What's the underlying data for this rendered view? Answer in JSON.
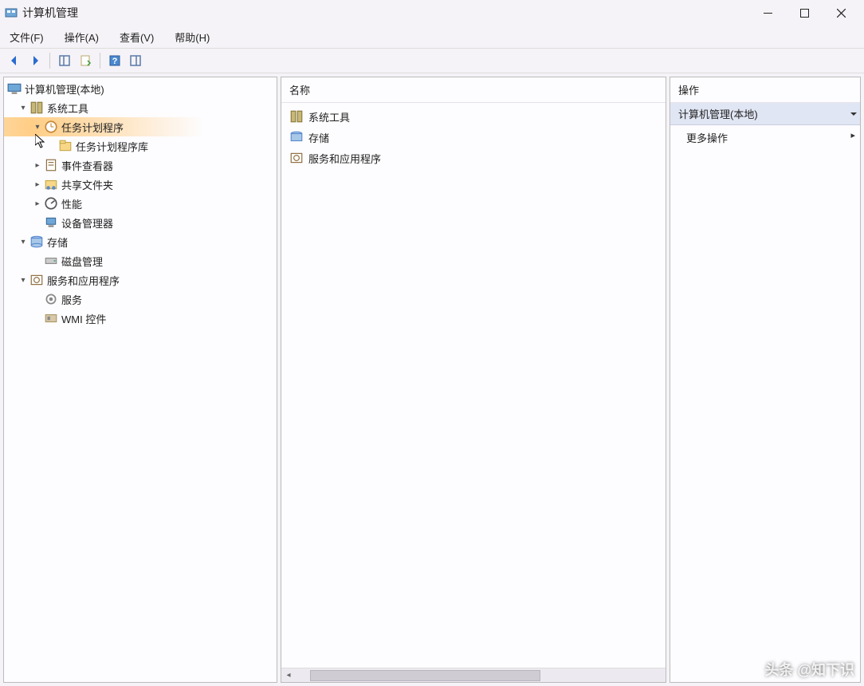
{
  "window": {
    "title": "计算机管理"
  },
  "menubar": {
    "file": "文件(F)",
    "action": "操作(A)",
    "view": "查看(V)",
    "help": "帮助(H)"
  },
  "tree": {
    "root": "计算机管理(本地)",
    "system_tools": "系统工具",
    "task_scheduler": "任务计划程序",
    "task_scheduler_library": "任务计划程序库",
    "event_viewer": "事件查看器",
    "shared_folders": "共享文件夹",
    "performance": "性能",
    "device_manager": "设备管理器",
    "storage": "存储",
    "disk_management": "磁盘管理",
    "services_apps": "服务和应用程序",
    "services": "服务",
    "wmi_control": "WMI 控件"
  },
  "middle": {
    "header": "名称",
    "items": {
      "system_tools": "系统工具",
      "storage": "存储",
      "services_apps": "服务和应用程序"
    }
  },
  "actions": {
    "header": "操作",
    "group": "计算机管理(本地)",
    "more": "更多操作"
  },
  "watermark": "头条 @知下识"
}
